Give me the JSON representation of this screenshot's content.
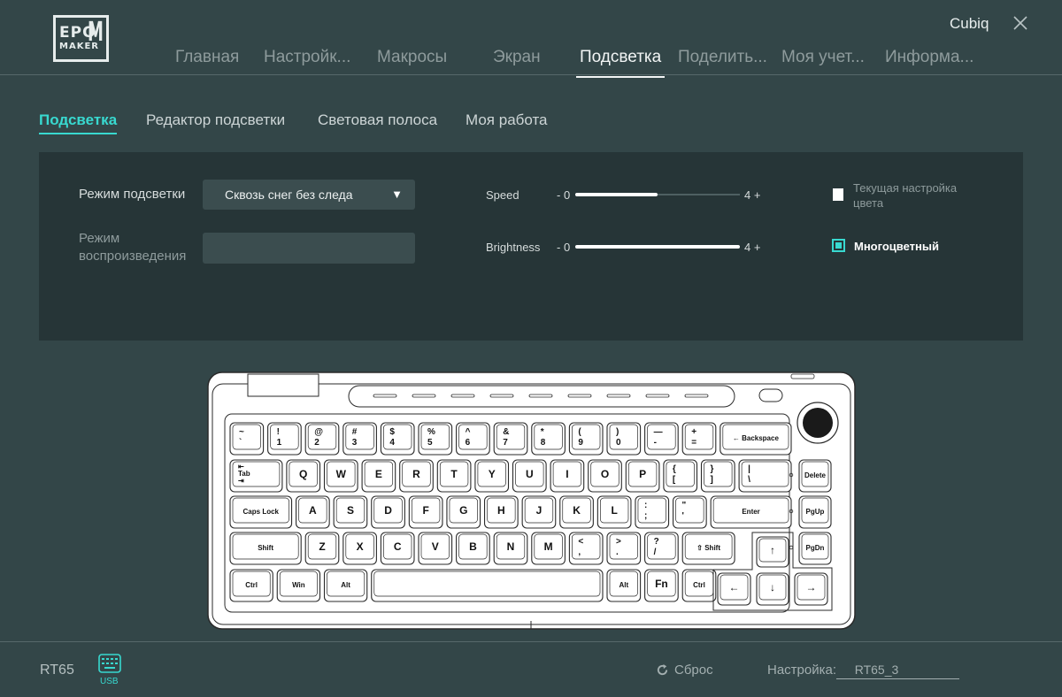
{
  "brand": {
    "line1": "EPO",
    "line2": "MAKER",
    "mark": "M"
  },
  "user": {
    "name": "Cubiq"
  },
  "nav": {
    "items": [
      {
        "label": "Главная"
      },
      {
        "label": "Настройк..."
      },
      {
        "label": "Макросы"
      },
      {
        "label": "Экран"
      },
      {
        "label": "Подсветка"
      },
      {
        "label": "Поделить..."
      },
      {
        "label": "Моя учет..."
      },
      {
        "label": "Информа..."
      }
    ],
    "active": "Подсветка"
  },
  "subtabs": {
    "items": [
      {
        "label": "Подсветка"
      },
      {
        "label": "Редактор подсветки"
      },
      {
        "label": "Световая полоса"
      },
      {
        "label": "Моя работа"
      }
    ],
    "active": "Подсветка"
  },
  "settings": {
    "mode_label": "Режим подсветки",
    "mode_value": "Сквозь снег без следа",
    "playback_label_1": "Режим",
    "playback_label_2": "воспроизведения",
    "playback_value": "",
    "speed": {
      "label": "Speed",
      "min": "- 0",
      "max": "4 +",
      "level_fraction": 0.5
    },
    "brightness": {
      "label": "Brightness",
      "min": "- 0",
      "max": "4 +",
      "level_fraction": 1.0
    },
    "color_options": {
      "current_1": "Текущая настройка",
      "current_2": "цвета",
      "multicolor": "Многоцветный",
      "selected": "Многоцветный"
    }
  },
  "keyboard": {
    "rows": [
      [
        [
          "~",
          "`"
        ],
        [
          "!",
          "1"
        ],
        [
          "@",
          "2"
        ],
        [
          "#",
          "3"
        ],
        [
          "$",
          "4"
        ],
        [
          "%",
          "5"
        ],
        [
          "^",
          "6"
        ],
        [
          "&",
          "7"
        ],
        [
          "*",
          "8"
        ],
        [
          "(",
          "9"
        ],
        [
          ")",
          "0"
        ],
        [
          "—",
          "-"
        ],
        [
          "+",
          "="
        ],
        [
          "← Backspace"
        ]
      ],
      [
        [
          "⇤",
          "Tab",
          "⇥"
        ],
        [
          "Q"
        ],
        [
          "W"
        ],
        [
          "E"
        ],
        [
          "R"
        ],
        [
          "T"
        ],
        [
          "Y"
        ],
        [
          "U"
        ],
        [
          "I"
        ],
        [
          "O"
        ],
        [
          "P"
        ],
        [
          "{",
          "["
        ],
        [
          "}",
          "]"
        ],
        [
          "|",
          "\\"
        ]
      ],
      [
        [
          "Caps Lock"
        ],
        [
          "A"
        ],
        [
          "S"
        ],
        [
          "D"
        ],
        [
          "F"
        ],
        [
          "G"
        ],
        [
          "H"
        ],
        [
          "J"
        ],
        [
          "K"
        ],
        [
          "L"
        ],
        [
          ":",
          ";"
        ],
        [
          "\"",
          "'"
        ],
        [
          "Enter"
        ]
      ],
      [
        [
          "Shift"
        ],
        [
          "Z"
        ],
        [
          "X"
        ],
        [
          "C"
        ],
        [
          "V"
        ],
        [
          "B"
        ],
        [
          "N"
        ],
        [
          "M"
        ],
        [
          "<",
          ","
        ],
        [
          ">",
          "."
        ],
        [
          "?",
          "/"
        ],
        [
          "⇧ Shift"
        ]
      ],
      [
        [
          "Ctrl"
        ],
        [
          "Win"
        ],
        [
          "Alt"
        ],
        [
          ""
        ],
        [
          "Alt"
        ],
        [
          "Fn"
        ],
        [
          "Ctrl"
        ]
      ]
    ],
    "side_keys": [
      "Delete",
      "PgUp",
      "PgDn"
    ],
    "arrows": [
      "↑",
      "←",
      "↓",
      "→"
    ]
  },
  "footer": {
    "device": "RT65",
    "connection": "USB",
    "reset": "Сброс",
    "profile_label": "Настройка:",
    "profile_value": "RT65_3"
  },
  "colors": {
    "background": "#334648",
    "panel": "#263537",
    "accent": "#38d9d0",
    "text": "#cfd6d7"
  },
  "icons": [
    "close-icon",
    "refresh-icon",
    "keyboard-usb-icon",
    "chevron-down-icon"
  ]
}
